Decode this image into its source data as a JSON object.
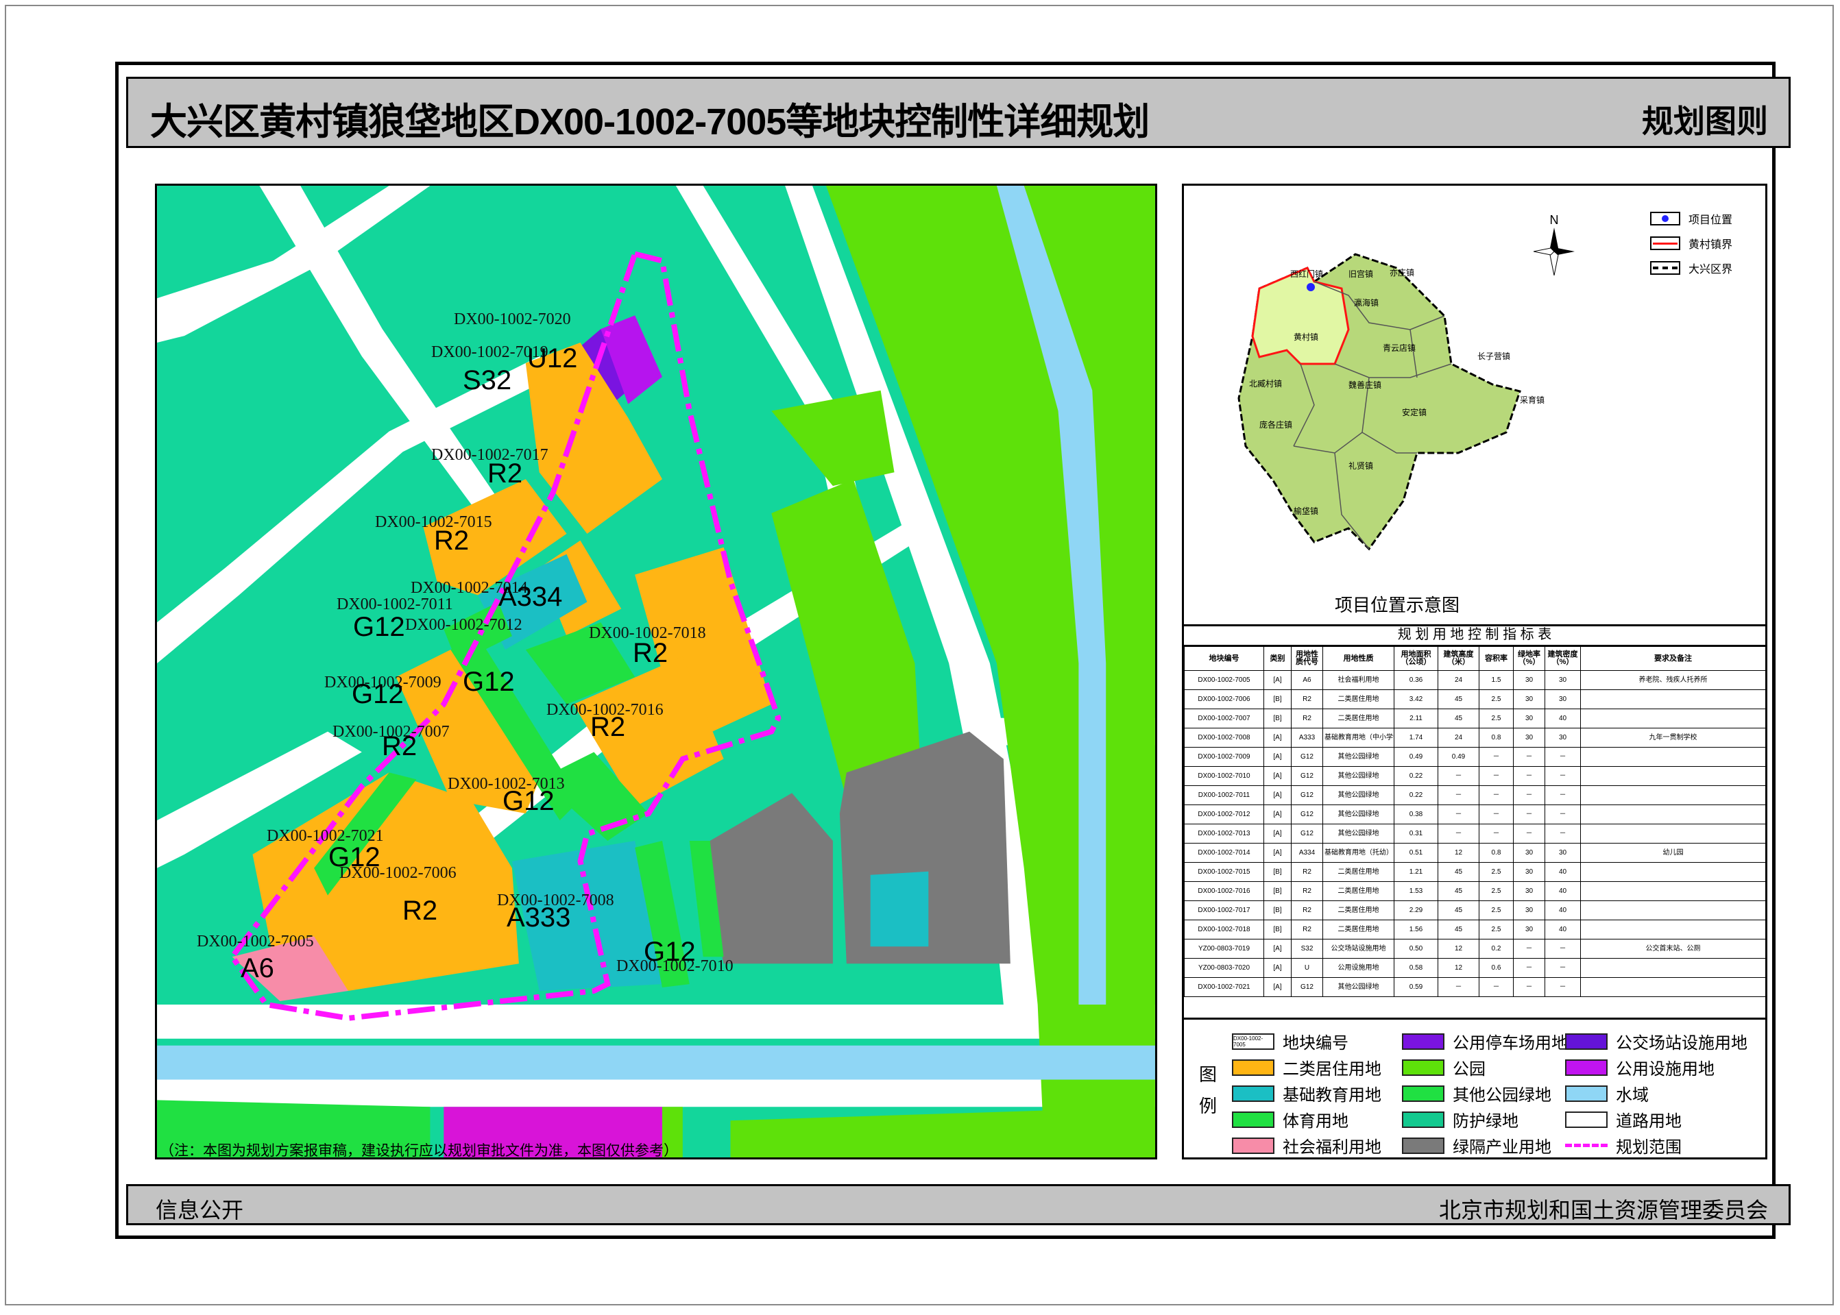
{
  "header": {
    "title": "大兴区黄村镇狼垡地区DX00-1002-7005等地块控制性详细规划",
    "subtitle": "规划图则"
  },
  "footer": {
    "left": "信息公开",
    "right": "北京市规划和国土资源管理委员会"
  },
  "map": {
    "note": "（注：本图为规划方案报审稿，建设执行应以规划审批文件为准，本图仅供参考）",
    "colors": {
      "protection_green": "#13d69b",
      "park": "#5ee10a",
      "other_park_green": "#20e042",
      "residential": "#ffb514",
      "basic_education": "#1bbfc4",
      "sports": "#20e042",
      "welfare": "#f78ca8",
      "parking": "#7a14e0",
      "public_facility": "#b614ee",
      "water": "#8fd6f5",
      "industry_green": "#7a7a7a",
      "boundary": "#ff14ff"
    },
    "parcel_labels": [
      {
        "id": "DX00-1002-7020",
        "code": ""
      },
      {
        "id": "DX00-1002-7019",
        "code": "U12"
      },
      {
        "id": "",
        "code": "S32"
      },
      {
        "id": "DX00-1002-7017",
        "code": "R2"
      },
      {
        "id": "DX00-1002-7015",
        "code": "R2"
      },
      {
        "id": "DX00-1002-7014",
        "code": "A334"
      },
      {
        "id": "DX00-1002-7011",
        "code": "G12"
      },
      {
        "id": "DX00-1002-7012",
        "code": "G12"
      },
      {
        "id": "DX00-1002-7018",
        "code": "R2"
      },
      {
        "id": "DX00-1002-7009",
        "code": "G12"
      },
      {
        "id": "DX00-1002-7016",
        "code": "R2"
      },
      {
        "id": "DX00-1002-7007",
        "code": "R2"
      },
      {
        "id": "DX00-1002-7013",
        "code": "G12"
      },
      {
        "id": "DX00-1002-7021",
        "code": "G12"
      },
      {
        "id": "DX00-1002-7006",
        "code": "R2"
      },
      {
        "id": "DX00-1002-7008",
        "code": "A333"
      },
      {
        "id": "DX00-1002-7005",
        "code": "A6"
      },
      {
        "id": "DX00-1002-7010",
        "code": "G12"
      }
    ]
  },
  "inset": {
    "caption": "项目位置示意图",
    "north": "N",
    "legend": [
      {
        "label": "项目位置",
        "icon": "blue-dot-icon"
      },
      {
        "label": "黄村镇界",
        "icon": "red-line-icon"
      },
      {
        "label": "大兴区界",
        "icon": "black-dash-line-icon"
      }
    ],
    "towns": [
      "西红门镇",
      "旧宫镇",
      "亦庄镇",
      "瀛海镇",
      "黄村镇",
      "青云店镇",
      "长子营镇",
      "北臧村镇",
      "魏善庄镇",
      "采育镇",
      "安定镇",
      "庞各庄镇",
      "礼贤镇",
      "榆垡镇"
    ]
  },
  "control_table": {
    "title": "规 划 用 地 控 制 指 标 表",
    "columns": [
      "地块编号",
      "类别",
      "用地性质代号",
      "用地性质",
      "用地面积（公顷）",
      "建筑高度（米）",
      "容积率",
      "绿地率（%）",
      "建筑密度（%）",
      "要求及备注"
    ],
    "rows": [
      [
        "DX00-1002-7005",
        "[A]",
        "A6",
        "社会福利用地",
        "0.36",
        "24",
        "1.5",
        "30",
        "30",
        "养老院、残疾人托养所"
      ],
      [
        "DX00-1002-7006",
        "[B]",
        "R2",
        "二类居住用地",
        "3.42",
        "45",
        "2.5",
        "30",
        "30",
        ""
      ],
      [
        "DX00-1002-7007",
        "[B]",
        "R2",
        "二类居住用地",
        "2.11",
        "45",
        "2.5",
        "30",
        "40",
        ""
      ],
      [
        "DX00-1002-7008",
        "[A]",
        "A333",
        "基础教育用地（中小学合校）",
        "1.74",
        "24",
        "0.8",
        "30",
        "30",
        "九年一贯制学校"
      ],
      [
        "DX00-1002-7009",
        "[A]",
        "G12",
        "其他公园绿地",
        "0.49",
        "0.49",
        "－",
        "－",
        "－",
        ""
      ],
      [
        "DX00-1002-7010",
        "[A]",
        "G12",
        "其他公园绿地",
        "0.22",
        "－",
        "－",
        "－",
        "－",
        ""
      ],
      [
        "DX00-1002-7011",
        "[A]",
        "G12",
        "其他公园绿地",
        "0.22",
        "－",
        "－",
        "－",
        "－",
        ""
      ],
      [
        "DX00-1002-7012",
        "[A]",
        "G12",
        "其他公园绿地",
        "0.38",
        "－",
        "－",
        "－",
        "－",
        ""
      ],
      [
        "DX00-1002-7013",
        "[A]",
        "G12",
        "其他公园绿地",
        "0.31",
        "－",
        "－",
        "－",
        "－",
        ""
      ],
      [
        "DX00-1002-7014",
        "[A]",
        "A334",
        "基础教育用地（托幼）",
        "0.51",
        "12",
        "0.8",
        "30",
        "30",
        "幼儿园"
      ],
      [
        "DX00-1002-7015",
        "[B]",
        "R2",
        "二类居住用地",
        "1.21",
        "45",
        "2.5",
        "30",
        "40",
        ""
      ],
      [
        "DX00-1002-7016",
        "[B]",
        "R2",
        "二类居住用地",
        "1.53",
        "45",
        "2.5",
        "30",
        "40",
        ""
      ],
      [
        "DX00-1002-7017",
        "[B]",
        "R2",
        "二类居住用地",
        "2.29",
        "45",
        "2.5",
        "30",
        "40",
        ""
      ],
      [
        "DX00-1002-7018",
        "[B]",
        "R2",
        "二类居住用地",
        "1.56",
        "45",
        "2.5",
        "30",
        "40",
        ""
      ],
      [
        "YZ00-0803-7019",
        "[A]",
        "S32",
        "公交场站设施用地",
        "0.50",
        "12",
        "0.2",
        "－",
        "－",
        "公交首末站、公厕"
      ],
      [
        "YZ00-0803-7020",
        "[A]",
        "U",
        "公用设施用地",
        "0.58",
        "12",
        "0.6",
        "－",
        "－",
        ""
      ],
      [
        "DX00-1002-7021",
        "[A]",
        "G12",
        "其他公园绿地",
        "0.59",
        "－",
        "－",
        "－",
        "－",
        ""
      ]
    ]
  },
  "legend": {
    "title_top": "图",
    "title_bottom": "例",
    "items": [
      {
        "label": "地块编号",
        "color": "#ffffff",
        "sample": "DX00-1002-7005"
      },
      {
        "label": "二类居住用地",
        "color": "#ffb514"
      },
      {
        "label": "基础教育用地",
        "color": "#1bbfc4"
      },
      {
        "label": "体育用地",
        "color": "#20e042"
      },
      {
        "label": "社会福利用地",
        "color": "#f78ca8"
      },
      {
        "label": "公用停车场用地",
        "color": "#7a14e0"
      },
      {
        "label": "公园",
        "color": "#5ee10a"
      },
      {
        "label": "其他公园绿地",
        "color": "#20e042"
      },
      {
        "label": "防护绿地",
        "color": "#13c98f"
      },
      {
        "label": "绿隔产业用地",
        "color": "#7a7a7a"
      },
      {
        "label": "公交场站设施用地",
        "color": "#6414d8"
      },
      {
        "label": "公用设施用地",
        "color": "#c114f0"
      },
      {
        "label": "水域",
        "color": "#8fd6f5"
      },
      {
        "label": "道路用地",
        "color": "#ffffff"
      },
      {
        "label": "规划范围",
        "color": "#ff14ff"
      }
    ]
  }
}
